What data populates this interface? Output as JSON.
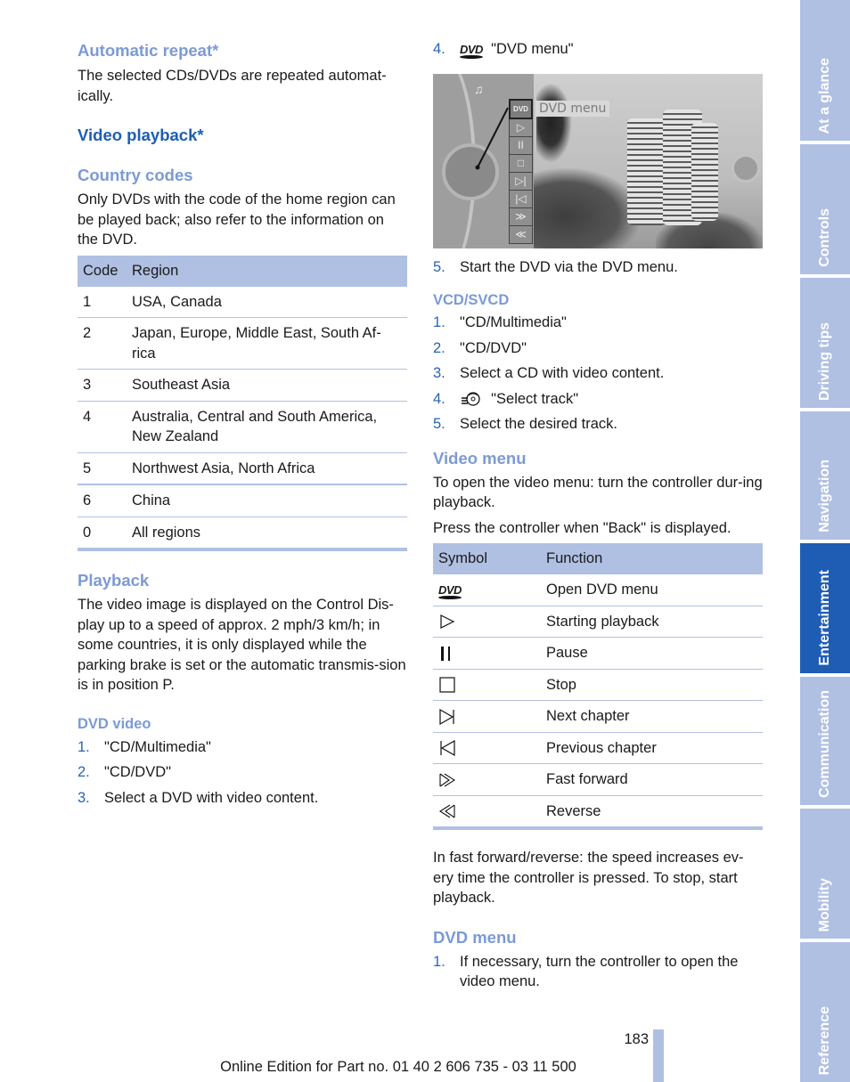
{
  "left_column": {
    "automatic_repeat": {
      "heading": "Automatic repeat*",
      "text": "The selected CDs/DVDs are repeated automat-ically."
    },
    "video_playback": {
      "heading": "Video playback*"
    },
    "country_codes": {
      "heading": "Country codes",
      "text": "Only DVDs with the code of the home region can be played back; also refer to the information on the DVD.",
      "table": {
        "headers": [
          "Code",
          "Region"
        ],
        "rows": [
          {
            "code": "1",
            "region": "USA, Canada"
          },
          {
            "code": "2",
            "region": "Japan, Europe, Middle East, South Af-rica"
          },
          {
            "code": "3",
            "region": "Southeast Asia"
          },
          {
            "code": "4",
            "region": "Australia, Central and South America, New Zealand"
          },
          {
            "code": "5",
            "region": "Northwest Asia, North Africa"
          },
          {
            "code": "6",
            "region": "China"
          },
          {
            "code": "0",
            "region": "All regions"
          }
        ]
      }
    },
    "playback": {
      "heading": "Playback",
      "text": "The video image is displayed on the Control Dis-play up to a speed of approx. 2 mph/3 km/h; in some countries, it is only displayed while the parking brake is set or the automatic transmis-sion is in position P."
    },
    "dvd_video": {
      "heading": "DVD video",
      "steps": [
        {
          "num": "1.",
          "text": "\"CD/Multimedia\""
        },
        {
          "num": "2.",
          "text": "\"CD/DVD\""
        },
        {
          "num": "3.",
          "text": "Select a DVD with video content."
        }
      ]
    }
  },
  "right_column": {
    "dvd_step4": {
      "num": "4.",
      "icon": "dvd-icon",
      "icon_text": "DVD",
      "text": "\"DVD menu\""
    },
    "screen": {
      "menu_label": "DVD menu",
      "buttons": [
        "dvd",
        "play",
        "pause",
        "stop",
        "next-chapter",
        "previous-chapter",
        "fast-forward",
        "reverse"
      ],
      "button_glyphs": [
        "DVD",
        "▷",
        "II",
        "□",
        "▷|",
        "|◁",
        "≫",
        "≪"
      ]
    },
    "dvd_step5": {
      "num": "5.",
      "text": "Start the DVD via the DVD menu."
    },
    "vcd": {
      "heading": "VCD/SVCD",
      "steps": [
        {
          "num": "1.",
          "text": "\"CD/Multimedia\""
        },
        {
          "num": "2.",
          "text": "\"CD/DVD\""
        },
        {
          "num": "3.",
          "text": "Select a CD with video content."
        },
        {
          "num": "4.",
          "icon": "select-track-icon",
          "text": "\"Select track\""
        },
        {
          "num": "5.",
          "text": "Select the desired track."
        }
      ]
    },
    "video_menu": {
      "heading": "Video menu",
      "text1": "To open the video menu: turn the controller dur-ing playback.",
      "text2": "Press the controller when \"Back\" is displayed.",
      "table": {
        "headers": [
          "Symbol",
          "Function"
        ],
        "rows": [
          {
            "symbol": "dvd-icon",
            "function": "Open DVD menu"
          },
          {
            "symbol": "play-icon",
            "function": "Starting playback"
          },
          {
            "symbol": "pause-icon",
            "function": "Pause"
          },
          {
            "symbol": "stop-icon",
            "function": "Stop"
          },
          {
            "symbol": "next-chapter-icon",
            "function": "Next chapter"
          },
          {
            "symbol": "previous-chapter-icon",
            "function": "Previous chapter"
          },
          {
            "symbol": "fast-forward-icon",
            "function": "Fast forward"
          },
          {
            "symbol": "reverse-icon",
            "function": "Reverse"
          }
        ]
      },
      "note": "In fast forward/reverse: the speed increases ev-ery time the controller is pressed. To stop, start playback."
    },
    "dvd_menu": {
      "heading": "DVD menu",
      "steps": [
        {
          "num": "1.",
          "text": "If necessary, turn the controller to open the video menu."
        }
      ]
    }
  },
  "sidebar": {
    "tabs": [
      {
        "label": "At a glance",
        "active": false
      },
      {
        "label": "Controls",
        "active": false
      },
      {
        "label": "Driving tips",
        "active": false
      },
      {
        "label": "Navigation",
        "active": false
      },
      {
        "label": "Entertainment",
        "active": true
      },
      {
        "label": "Communication",
        "active": false
      },
      {
        "label": "Mobility",
        "active": false
      },
      {
        "label": "Reference",
        "active": false
      }
    ]
  },
  "footer": {
    "page_number": "183",
    "edition": "Online Edition for Part no. 01 40 2 606 735 - 03 11 500"
  },
  "colors": {
    "heading_light": "#7b9ad6",
    "heading_dark": "#1f5db5",
    "table_header": "#b0c0e3",
    "tab_inactive": "#b0c0e3",
    "tab_active": "#1f5db5"
  }
}
